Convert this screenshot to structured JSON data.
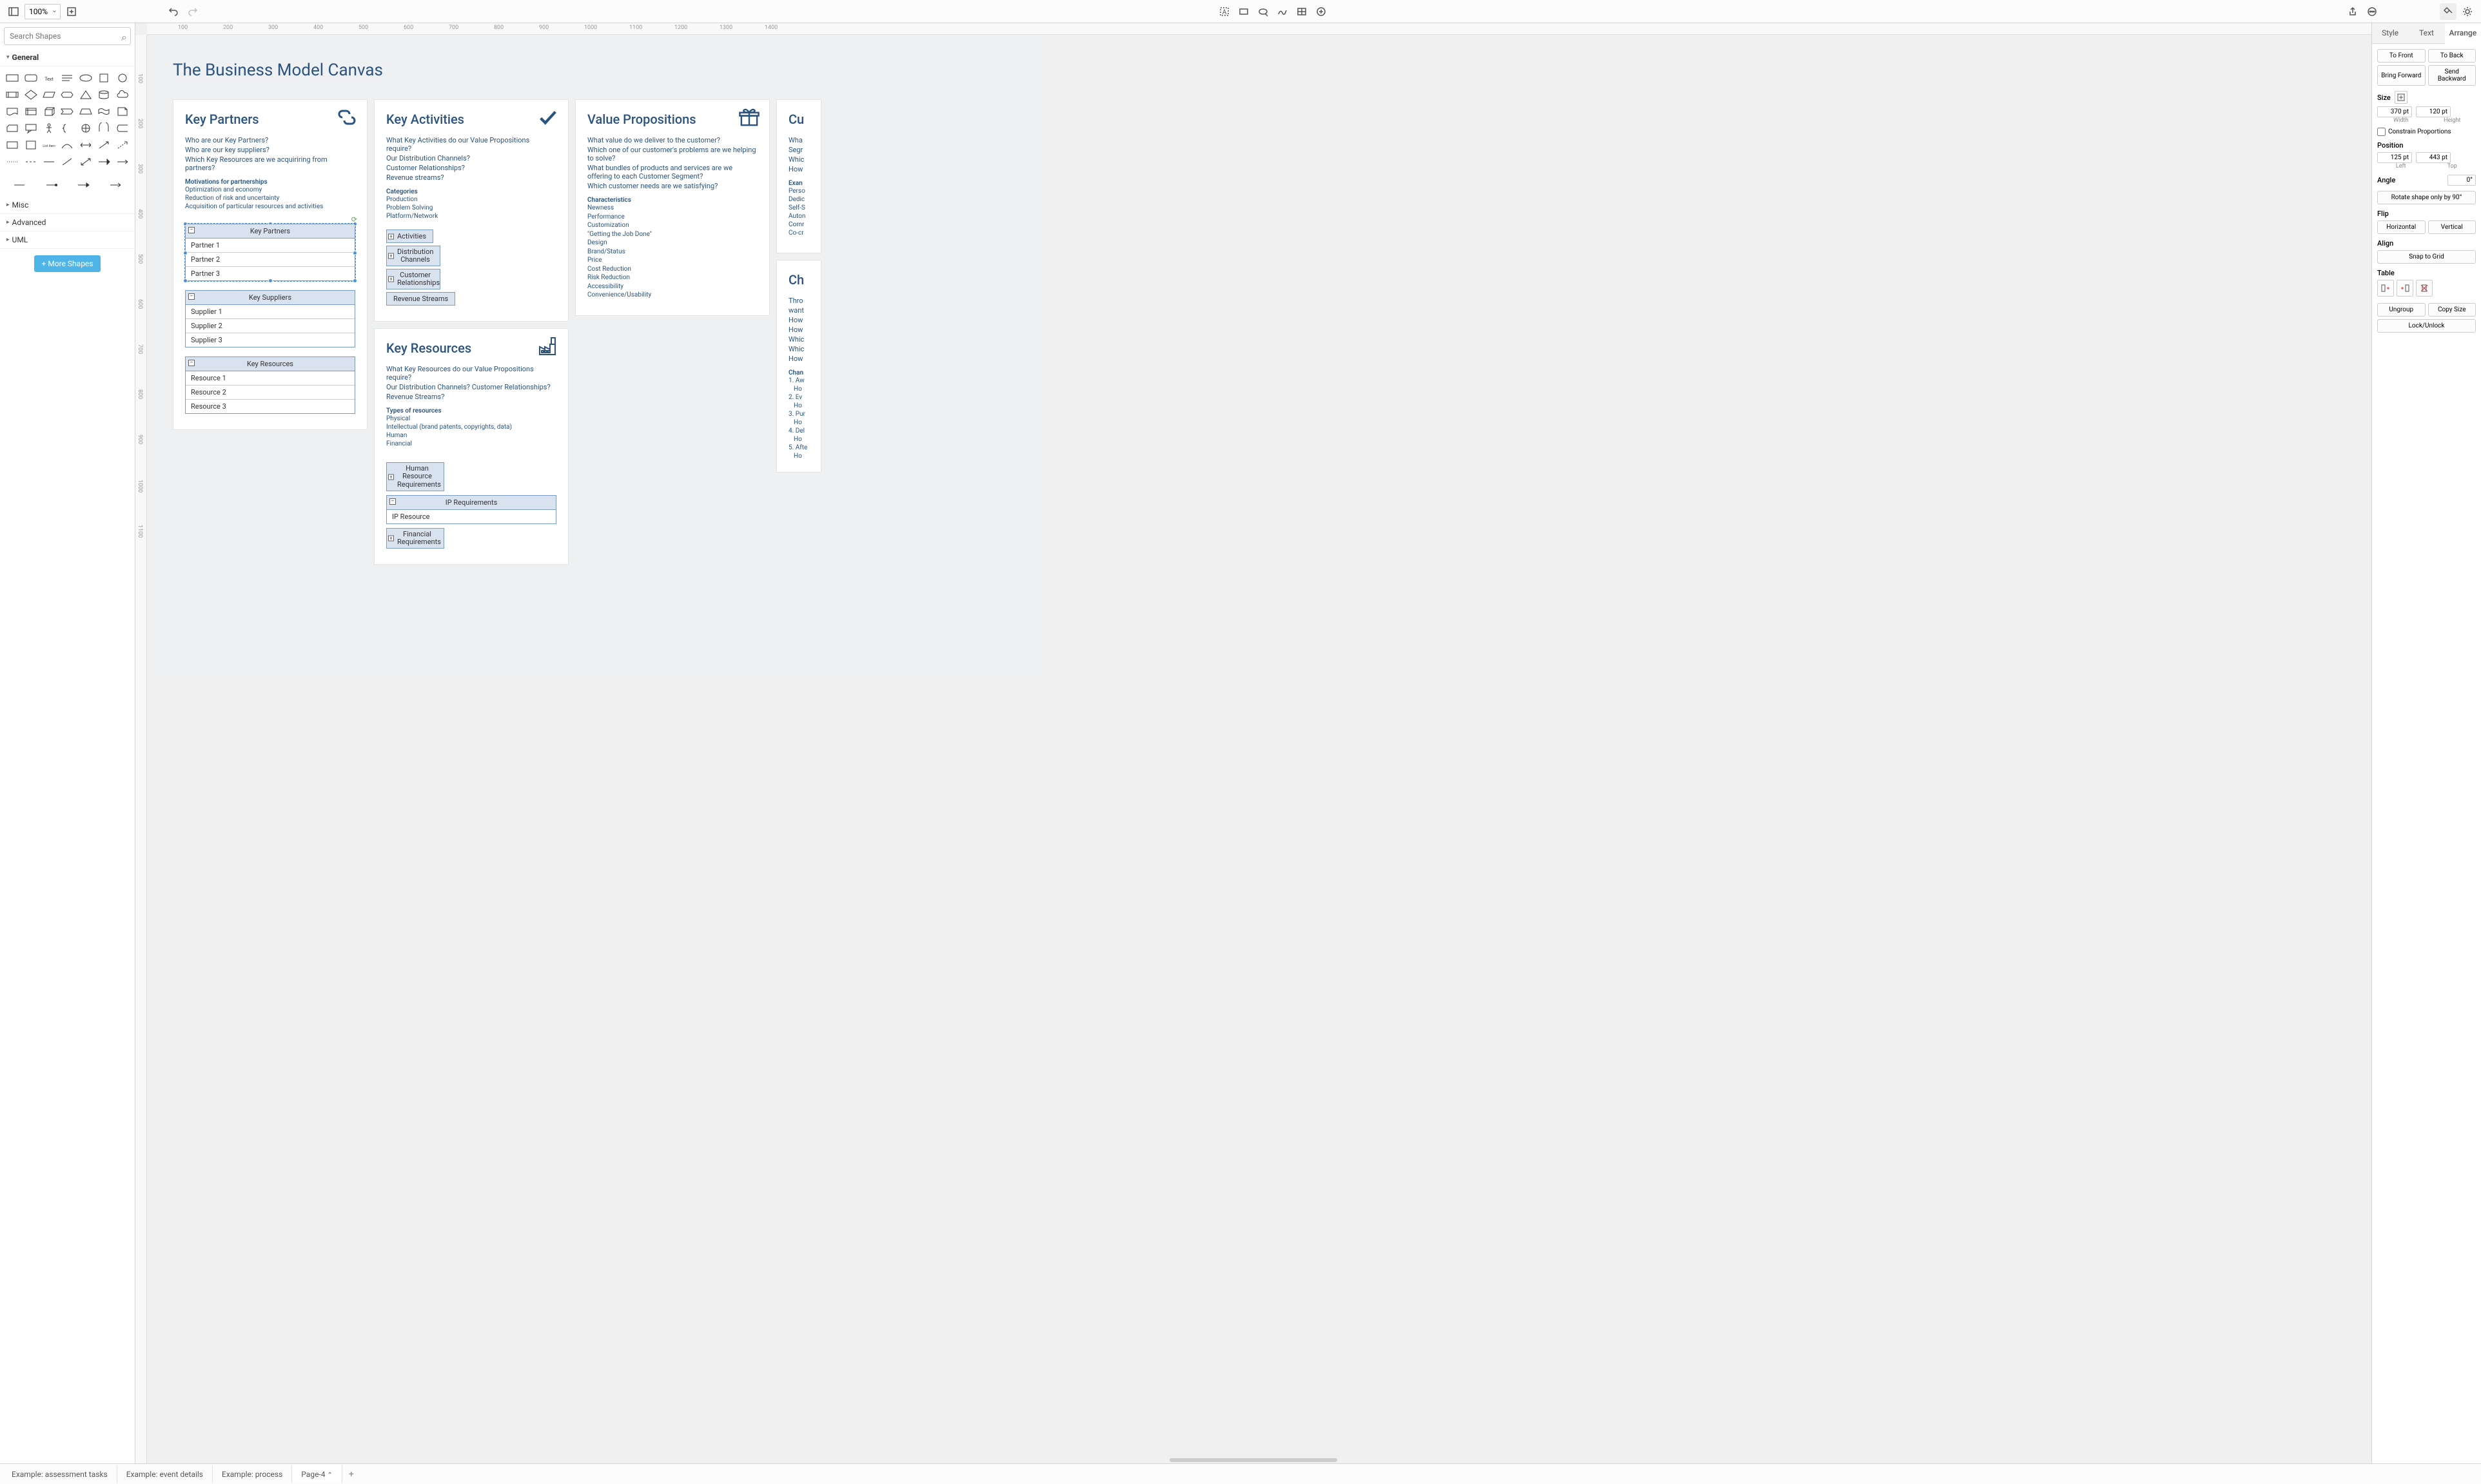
{
  "toolbar": {
    "zoom": "100%"
  },
  "sidebar": {
    "search_placeholder": "Search Shapes",
    "cat_general": "General",
    "cat_misc": "Misc",
    "cat_advanced": "Advanced",
    "cat_uml": "UML",
    "more_shapes": "More Shapes"
  },
  "canvas": {
    "title": "The Business Model Canvas",
    "kp": {
      "title": "Key Partners",
      "q1": "Who are our Key Partners?",
      "q2": "Who are our key suppliers?",
      "q3": "Which Key Resources are we acquiriring from partners?",
      "sub": "Motivations for partnerships",
      "m1": "Optimization and economy",
      "m2": "Reduction of risk and uncertainty",
      "m3": "Acquisition of particular resources and activities",
      "t1": {
        "h": "Key Partners",
        "r1": "Partner 1",
        "r2": "Partner 2",
        "r3": "Partner 3"
      },
      "t2": {
        "h": "Key Suppliers",
        "r1": "Supplier 1",
        "r2": "Supplier 2",
        "r3": "Supplier 3"
      },
      "t3": {
        "h": "Key Resources",
        "r1": "Resource 1",
        "r2": "Resource 2",
        "r3": "Resource 3"
      }
    },
    "ka": {
      "title": "Key Activities",
      "q1": "What Key Activities do our Value Propositions require?",
      "q2": "Our Distribution Channels?",
      "q3": "Customer Relationships?",
      "q4": "Revenue streams?",
      "sub": "Categories",
      "c1": "Production",
      "c2": "Problem Solving",
      "c3": "Platform/Network",
      "b1": "Activities",
      "b2": "Distribution Channels",
      "b3": "Customer Relationships",
      "b4": "Revenue Streams"
    },
    "kr": {
      "title": "Key Resources",
      "q1": "What Key Resources do our Value Propositions require?",
      "q2": "Our Distribution Channels? Customer Relationships?",
      "q3": "Revenue Streams?",
      "sub": "Types of resources",
      "t1": "Physical",
      "t2": "Intellectual (brand patents, copyrights, data)",
      "t3": "Human",
      "t4": "Financial",
      "b1": "Human Resource Requirements",
      "ip_h": "IP Requirements",
      "ip_r": "IP Resource",
      "b2": "Financial Requirements"
    },
    "vp": {
      "title": "Value Propositions",
      "q1": "What value do we deliver to the customer?",
      "q2": "Which one of our customer's problems are we helping to solve?",
      "q3": "What bundles of products and services are we offering to each Customer Segment?",
      "q4": "Which customer needs are we satisfying?",
      "sub": "Characteristics",
      "c1": "Newness",
      "c2": "Performance",
      "c3": "Customization",
      "c4": "\"Getting the Job Done\"",
      "c5": "Design",
      "c6": "Brand/Status",
      "c7": "Price",
      "c8": "Cost Reduction",
      "c9": "Risk Reduction",
      "c10": "Accessibility",
      "c11": "Convenience/Usability"
    },
    "cs": {
      "title": "Cu",
      "q1": "Wha",
      "q2": "Segr",
      "q3": "Whic",
      "q4": "How",
      "sub": "Exan",
      "l1": "Perso",
      "l2": "Dedic",
      "l3": "Self-S",
      "l4": "Auton",
      "l5": "Comr",
      "l6": "Co-cr"
    },
    "ch": {
      "title": "Ch",
      "q1": "Thro",
      "q2": "want",
      "q3": "How",
      "q4": "How",
      "q5": "Whic",
      "q6": "Whic",
      "q7": "How",
      "sub": "Chan",
      "l1": "1. Aw",
      "l2": "Ho",
      "l3": "2. Ev",
      "l4": "Ho",
      "l5": "3. Pur",
      "l6": "Ho",
      "l7": "4. Del",
      "l8": "Ho",
      "l9": "5. Afte",
      "l10": "Ho"
    }
  },
  "right": {
    "tab_style": "Style",
    "tab_text": "Text",
    "tab_arrange": "Arrange",
    "to_front": "To Front",
    "to_back": "To Back",
    "bring_forward": "Bring Forward",
    "send_backward": "Send Backward",
    "size": "Size",
    "width": "Width",
    "height": "Height",
    "w": "370 pt",
    "h": "120 pt",
    "constrain": "Constrain Proportions",
    "position": "Position",
    "left": "Left",
    "top": "Top",
    "x": "125 pt",
    "y": "443 pt",
    "angle": "Angle",
    "angle_v": "0°",
    "rotate90": "Rotate shape only by 90°",
    "flip": "Flip",
    "horizontal": "Horizontal",
    "vertical": "Vertical",
    "align": "Align",
    "snap": "Snap to Grid",
    "table": "Table",
    "ungroup": "Ungroup",
    "copy_size": "Copy Size",
    "lock": "Lock/Unlock"
  },
  "bottom": {
    "t1": "Example: assessment tasks",
    "t2": "Example: event details",
    "t3": "Example: process",
    "t4": "Page-4"
  },
  "ruler_h": [
    "100",
    "200",
    "300",
    "400",
    "500",
    "600",
    "700",
    "800",
    "900",
    "1000",
    "1100",
    "1200",
    "1300",
    "1400"
  ],
  "ruler_v": [
    "100",
    "200",
    "300",
    "400",
    "500",
    "600",
    "700",
    "800",
    "900",
    "1000",
    "1100"
  ]
}
